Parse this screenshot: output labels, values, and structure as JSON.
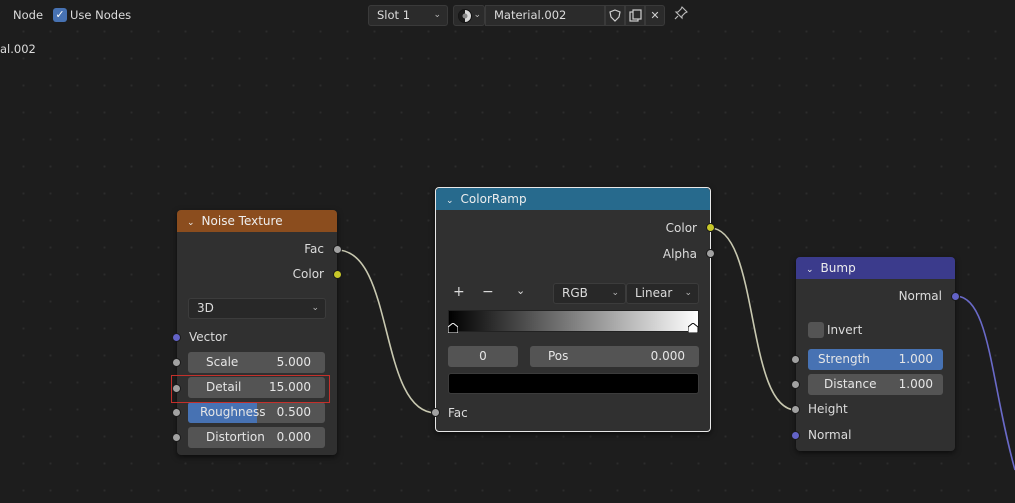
{
  "header": {
    "editor_label": "Node",
    "use_nodes_label": "Use Nodes",
    "use_nodes_checked": true,
    "slot_value": "Slot 1",
    "material_name": "Material.002"
  },
  "canvas": {
    "path_label": "al.002"
  },
  "nodes": {
    "noise": {
      "title": "Noise Texture",
      "header_color": "#8b4d1e",
      "outputs": {
        "fac": "Fac",
        "color": "Color"
      },
      "dimension": "3D",
      "inputs": {
        "vector": "Vector",
        "scale_label": "Scale",
        "scale_value": "5.000",
        "detail_label": "Detail",
        "detail_value": "15.000",
        "roughness_label": "Roughness",
        "roughness_value": "0.500",
        "roughness_fraction": 0.5,
        "distortion_label": "Distortion",
        "distortion_value": "0.000"
      }
    },
    "colorramp": {
      "title": "ColorRamp",
      "header_color": "#276a8d",
      "outputs": {
        "color": "Color",
        "alpha": "Alpha"
      },
      "color_mode": "RGB",
      "interpolation": "Linear",
      "active_stop_index": "0",
      "pos_label": "Pos",
      "pos_value": "0.000",
      "stop_color": "#000000",
      "input_fac": "Fac"
    },
    "bump": {
      "title": "Bump",
      "header_color": "#3b3b8c",
      "outputs": {
        "normal": "Normal"
      },
      "invert_label": "Invert",
      "strength_label": "Strength",
      "strength_value": "1.000",
      "distance_label": "Distance",
      "distance_value": "1.000",
      "input_height": "Height",
      "input_normal": "Normal"
    }
  },
  "colors": {
    "socket_gray": "#a1a1a1",
    "socket_yellow": "#c7c729",
    "socket_vector": "#6363c7",
    "accent_blue": "#4772b3",
    "link_color": "#c8c8b0",
    "highlight_red": "#c4302b"
  }
}
